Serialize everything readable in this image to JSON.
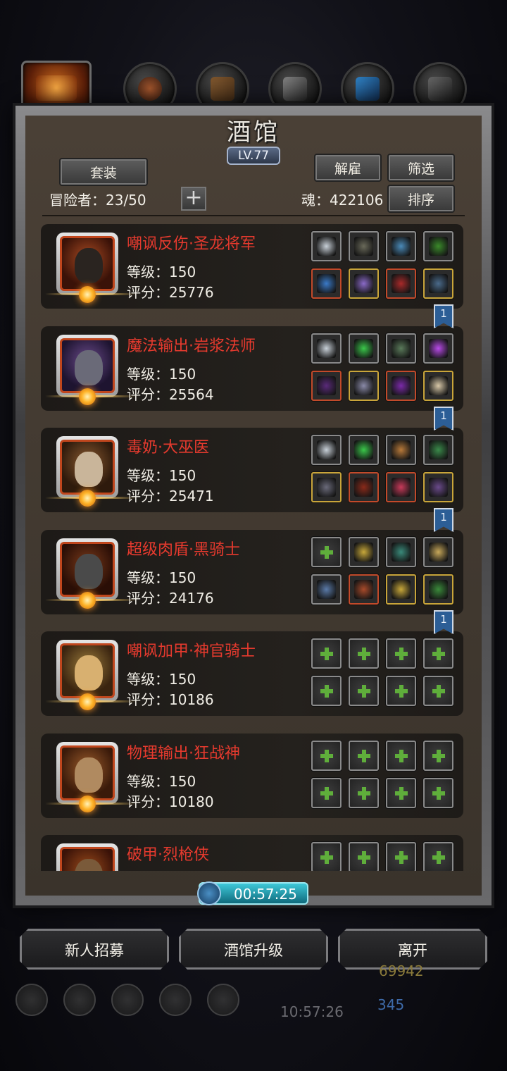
{
  "window": {
    "title": "酒馆",
    "level": "LV.77"
  },
  "toolbar": {
    "outfit_label": "套装",
    "dismiss_label": "解雇",
    "filter_label": "筛选",
    "sort_label": "排序",
    "add_symbol": "+"
  },
  "stats": {
    "adventurers": "冒险者：23/50",
    "soul": "魂：422106"
  },
  "heroes": [
    {
      "name": "嘲讽反伤·圣龙将军",
      "level": "等级：150",
      "score": "评分：25776"
    },
    {
      "name": "魔法输出·岩浆法师",
      "level": "等级：150",
      "score": "评分：25564"
    },
    {
      "name": "毒奶·大巫医",
      "level": "等级：150",
      "score": "评分：25471"
    },
    {
      "name": "超级肉盾·黑骑士",
      "level": "等级：150",
      "score": "评分：24176"
    },
    {
      "name": "嘲讽加甲·神官骑士",
      "level": "等级：150",
      "score": "评分：10186"
    },
    {
      "name": "物理输出·狂战神",
      "level": "等级：150",
      "score": "评分：10180"
    },
    {
      "name": "破甲·烈枪侠",
      "level": "",
      "score": ""
    }
  ],
  "bookmarks": [
    "1",
    "1",
    "1",
    "1"
  ],
  "timer": "00:57:25",
  "buttons": {
    "recruit": "新人招募",
    "upgrade": "酒馆升级",
    "leave": "离开"
  },
  "hud": {
    "clock": "10:57:26",
    "gold": "69942",
    "gems": "345"
  },
  "colors": {
    "hero_name": "#e63a2e",
    "panel_bg": "#3f372e",
    "timer": "#2fb8c9"
  }
}
